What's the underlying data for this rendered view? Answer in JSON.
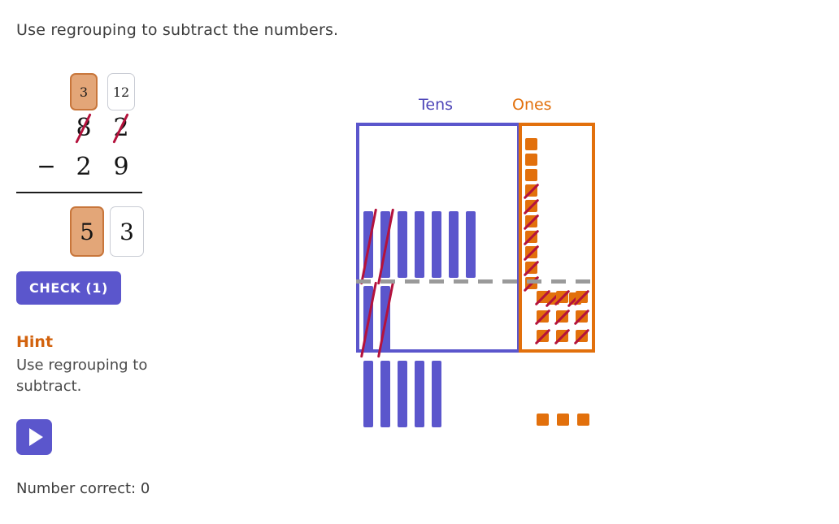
{
  "prompt": "Use regrouping to subtract the numbers.",
  "problem": {
    "regroup_tens": "3",
    "regroup_ones": "12",
    "minuend_tens": "8",
    "minuend_ones": "2",
    "operator": "−",
    "subtrahend_tens": "2",
    "subtrahend_ones": "9",
    "answer_tens": "5",
    "answer_ones": "3"
  },
  "controls": {
    "check_label": "CHECK (1)",
    "play_icon": "play-icon"
  },
  "hint": {
    "title": "Hint",
    "text": "Use regrouping to subtract."
  },
  "score": {
    "label": "Number correct: 0"
  },
  "model": {
    "tens_label": "Tens",
    "ones_label": "Ones",
    "tens_above_line": 7,
    "tens_above_struck": 2,
    "tens_below_line": 2,
    "tens_below_struck": 2,
    "tens_result": 5,
    "ones_column_plain": 3,
    "ones_column_struck": 7,
    "ones_row_struck": 2,
    "ones_below_grid": 9,
    "ones_result": 3
  },
  "colors": {
    "purple": "#5b56cc",
    "orange": "#e2700c",
    "crimson": "#b4123c",
    "tan_fill": "#e3a678",
    "tan_border": "#c8763b",
    "gray_dash": "#9a9a9a",
    "hint_orange": "#d2620d"
  }
}
